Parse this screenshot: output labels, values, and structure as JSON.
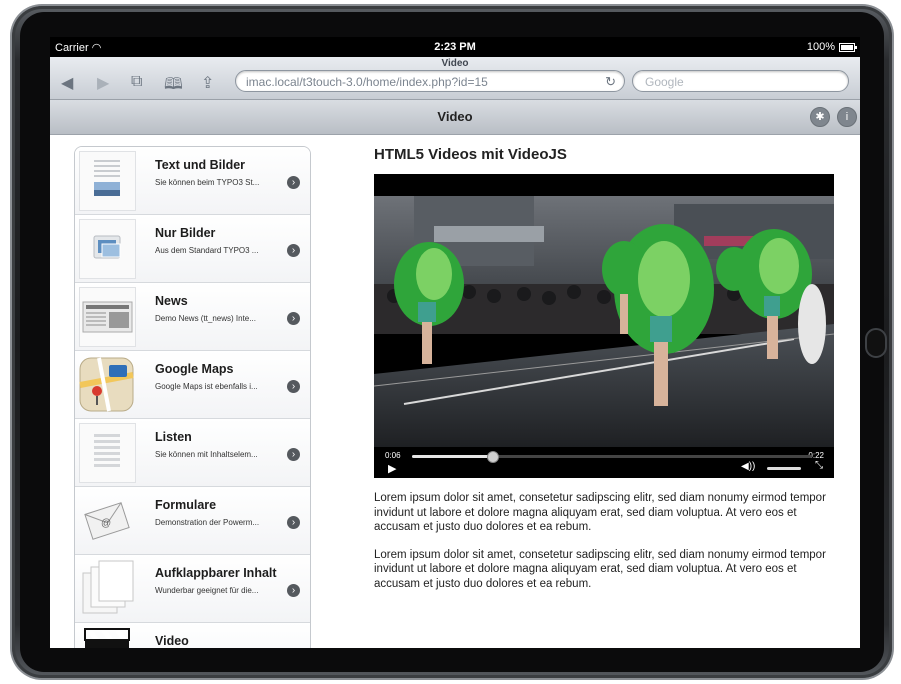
{
  "status_bar": {
    "carrier": "Carrier",
    "time": "2:23 PM",
    "battery": "100%"
  },
  "safari": {
    "page_title": "Video",
    "url": "imac.local/t3touch-3.0/home/index.php?id=15",
    "search_placeholder": "Google"
  },
  "app_bar": {
    "title": "Video"
  },
  "sidebar": {
    "items": [
      {
        "title": "Text und Bilder",
        "desc": "Sie können beim TYPO3 St..."
      },
      {
        "title": "Nur Bilder",
        "desc": "Aus dem Standard TYPO3 ..."
      },
      {
        "title": "News",
        "desc": "Demo News (tt_news) Inte..."
      },
      {
        "title": "Google Maps",
        "desc": "Google Maps ist ebenfalls i..."
      },
      {
        "title": "Listen",
        "desc": "Sie können mit Inhaltselem..."
      },
      {
        "title": "Formulare",
        "desc": "Demonstration der Powerm..."
      },
      {
        "title": "Aufklappbarer Inhalt",
        "desc": "Wunderbar geeignet für die..."
      },
      {
        "title": "Video",
        "desc": ""
      }
    ]
  },
  "main": {
    "heading": "HTML5 Videos mit VideoJS",
    "video": {
      "elapsed": "0:06",
      "remaining": "-0:22",
      "progress": 0.2
    },
    "paragraphs": [
      "Lorem ipsum dolor sit amet, consetetur sadipscing elitr, sed diam nonumy eirmod tempor invidunt ut labore et dolore magna aliquyam erat, sed diam voluptua. At vero eos et accusam et justo duo dolores et ea rebum.",
      "Lorem ipsum dolor sit amet, consetetur sadipscing elitr, sed diam nonumy eirmod tempor invidunt ut labore et dolore magna aliquyam erat, sed diam voluptua. At vero eos et accusam et justo duo dolores et ea rebum."
    ]
  },
  "icons": {
    "back": "back-arrow-icon",
    "forward": "forward-arrow-icon",
    "tabs": "tabs-icon",
    "bookmarks": "bookmarks-icon",
    "share": "share-icon",
    "reload": "reload-icon",
    "chevron": "chevron-right-icon"
  }
}
